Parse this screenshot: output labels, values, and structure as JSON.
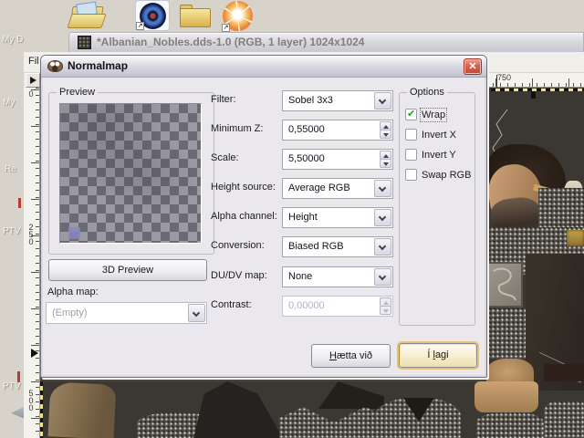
{
  "desktop": {
    "labels": {
      "my_d": "My D",
      "my": "My",
      "re": "Re",
      "ptv_upper": "PTV",
      "ptv_lower": "PTV"
    }
  },
  "gimp_window": {
    "title": "*Albanian_Nobles.dds-1.0 (RGB, 1 layer) 1024x1024",
    "menu_file": "Fil",
    "rulers": {
      "h_label": "750",
      "v_zero": "0",
      "v_250": "250",
      "v_500": "500"
    }
  },
  "dialog": {
    "title": "Normalmap",
    "preview": {
      "label": "Preview",
      "button_3d": "3D Preview",
      "alpha_map_label": "Alpha map:",
      "alpha_map_value": "(Empty)"
    },
    "fields": [
      {
        "label": "Filter:",
        "value": "Sobel 3x3",
        "control": "combo"
      },
      {
        "label": "Minimum Z:",
        "value": "0,55000",
        "control": "spin"
      },
      {
        "label": "Scale:",
        "value": "5,50000",
        "control": "spin"
      },
      {
        "label": "Height source:",
        "value": "Average RGB",
        "control": "combo"
      },
      {
        "label": "Alpha channel:",
        "value": "Height",
        "control": "combo"
      },
      {
        "label": "Conversion:",
        "value": "Biased RGB",
        "control": "combo"
      },
      {
        "label": "DU/DV map:",
        "value": "None",
        "control": "combo"
      },
      {
        "label": "Contrast:",
        "value": "0,00000",
        "control": "spin",
        "disabled": true
      }
    ],
    "options": {
      "label": "Options",
      "items": [
        {
          "label": "Wrap",
          "checked": true
        },
        {
          "label": "Invert X",
          "checked": false
        },
        {
          "label": "Invert Y",
          "checked": false
        },
        {
          "label": "Swap RGB",
          "checked": false
        }
      ]
    },
    "buttons": {
      "cancel_mnemonic": "H",
      "cancel_rest": "ætta við",
      "ok_pre": "Í ",
      "ok_mnemonic": "l",
      "ok_rest": "agi"
    },
    "check_glyph": "✔",
    "close_glyph": "✕"
  },
  "colors": {
    "ok_focus_ring": "#e8c46f",
    "check_green": "#21a121",
    "close_button_red": "#c24636",
    "layer_boundary_yellow": "#efe27a",
    "dialog_face": "#eae8ec"
  }
}
